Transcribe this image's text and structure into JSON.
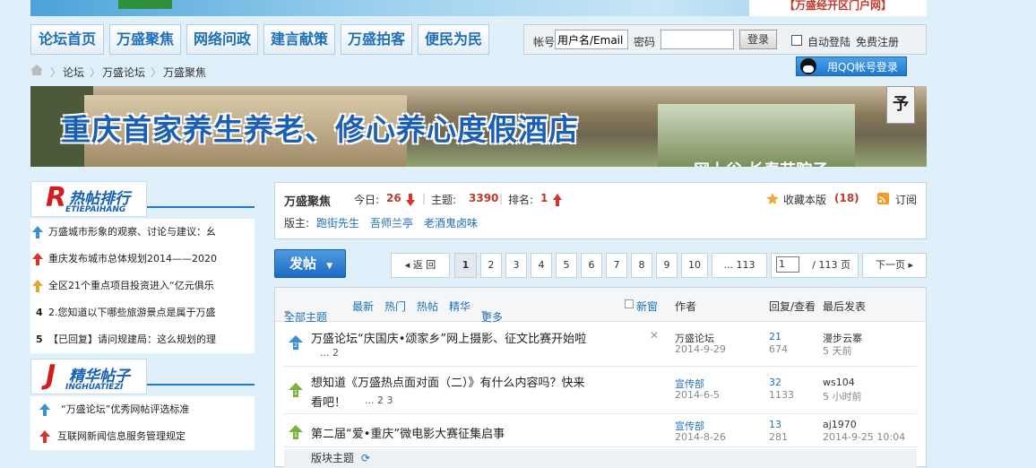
{
  "topbar": {
    "portal_text": "【万盛经开区门户网】"
  },
  "nav": {
    "items": [
      "论坛首页",
      "万盛聚焦",
      "网络问政",
      "建言献策",
      "万盛拍客",
      "便民为民"
    ]
  },
  "login": {
    "account_label": "帐号",
    "account_placeholder": "用户名/Email",
    "password_label": "密码",
    "login_button": "登录",
    "auto_login": "自动登陆",
    "register": "免费注册",
    "qq_login": "用QQ帐号登录"
  },
  "breadcrumb": [
    "论坛",
    "万盛论坛",
    "万盛聚焦"
  ],
  "banner": {
    "title": "重庆首家养生养老、修心养心度假酒店",
    "tag": "予",
    "sub": "网上谷 长寿艺院子"
  },
  "hot": {
    "logo_letter": "R",
    "logo_title": "热帖排行",
    "logo_pinyin": "ETIEPAIHANG",
    "items": [
      {
        "rank": "1",
        "icon": "rank-up-icon",
        "text": "万盛城市形象的观察、讨论与建议：幺"
      },
      {
        "rank": "2",
        "icon": "rank-new-icon",
        "text": "重庆发布城市总体规划2014——2020"
      },
      {
        "rank": "3",
        "icon": "rank-yellow-icon",
        "text": "全区21个重点项目投资进入“亿元俱乐"
      },
      {
        "rank": "4",
        "icon": "",
        "text": "2.您知道以下哪些旅游景点是属于万盛"
      },
      {
        "rank": "5",
        "icon": "",
        "text": "【已回复】请问规建局：这么规划的理"
      }
    ]
  },
  "essence": {
    "logo_letter": "J",
    "logo_title": "精华帖子",
    "logo_pinyin": "INGHUATIEZI",
    "items": [
      {
        "icon": "rank-up-icon",
        "text": "“万盛论坛”优秀网帖评选标准"
      },
      {
        "icon": "rank-new-icon",
        "text": "互联网新闻信息服务管理规定"
      }
    ]
  },
  "forum": {
    "name": "万盛聚焦",
    "today_label": "今日:",
    "today_value": "26",
    "topics_label": "主题:",
    "topics_value": "3390",
    "rank_label": "排名:",
    "rank_value": "1",
    "moderators_label": "版主:",
    "moderators": [
      "跑街先生",
      "吾师兰亭",
      "老酒鬼卤味"
    ],
    "favorite_label": "收藏本版",
    "favorite_count": "(18)",
    "subscribe_label": "订阅"
  },
  "toolbar": {
    "post_button": "发帖",
    "prev": "返 回",
    "pages": [
      "1",
      "2",
      "3",
      "4",
      "5",
      "6",
      "7",
      "8",
      "9",
      "10"
    ],
    "ellipsis_last": "... 113",
    "page_input": "1",
    "total": "/ 113 页",
    "next": "下一页"
  },
  "thread_head": {
    "all": "全部主题",
    "latest": "最新",
    "hotgate": "热门",
    "hotpost": "热帖",
    "digest": "精华",
    "more": "更多",
    "new_window": "新窗",
    "author": "作者",
    "reply_view": "回复/查看",
    "last_post": "最后发表"
  },
  "threads": [
    {
      "title": "万盛论坛“庆国庆•颂家乡”网上摄影、征文比赛开始啦",
      "pages": "... 2",
      "author": "万盛论坛",
      "date": "2014-9-29",
      "replies": "21",
      "views": "674",
      "last_user": "漫步云寨",
      "last_time": "5 天前"
    },
    {
      "title": "想知道《万盛热点面对面（二）》有什么内容吗？快来",
      "title2": "看吧！",
      "pages": "... 2 3",
      "author": "宣传部",
      "date": "2014-6-5",
      "replies": "32",
      "views": "1133",
      "last_user": "ws104",
      "last_time": "5 小时前"
    },
    {
      "title": "第二届“爱•重庆”微电影大赛征集启事",
      "pages": "",
      "author": "宣传部",
      "date": "2014-8-26",
      "replies": "13",
      "views": "281",
      "last_user": "aj1970",
      "last_time": "2014-9-25 10:04"
    }
  ],
  "section_bar": {
    "label": "版块主题"
  }
}
